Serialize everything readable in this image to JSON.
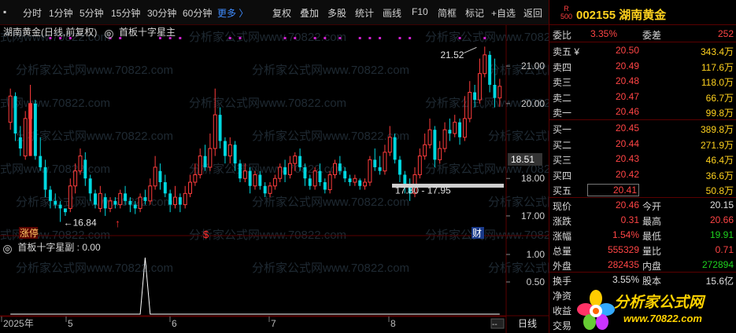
{
  "toolbar": {
    "periods": [
      "分时",
      "1分钟",
      "5分钟",
      "15分钟",
      "30分钟",
      "60分钟"
    ],
    "more": "更多 〉",
    "buttons": [
      "复权",
      "叠加",
      "多股",
      "统计",
      "画线",
      "F10",
      "简框",
      "标记",
      "+自选",
      "返回"
    ]
  },
  "main": {
    "legend": "湖南黄金(日线,前复权)",
    "indicator": "首板十字星主",
    "price_axis": [
      "21.00",
      "20.00",
      "18.00",
      "17.00"
    ],
    "current_price_tag": "18.51",
    "high_note": "21.52",
    "low_note": "←16.84",
    "range_note": "17.80 - 17.95",
    "markers": {
      "zhangting": "涨停",
      "dollar": "$",
      "cai": "财"
    }
  },
  "sub": {
    "legend": "首板十字星副 : 0.00",
    "axis": [
      "1.00",
      "0.50"
    ]
  },
  "xaxis": {
    "labels": [
      "2025年",
      "5",
      "6",
      "7",
      "8"
    ],
    "period": "日线"
  },
  "watermark": "分析家公式网www.70822.com",
  "stock": {
    "market_badge": "R\n500",
    "title": "002155 湖南黄金",
    "weibi_label": "委比",
    "weibi_value": "3.35%",
    "weicha_label": "委差",
    "weicha_value": "252"
  },
  "asks": [
    {
      "label": "卖五 ¥",
      "price": "20.50",
      "vol": "343.4万"
    },
    {
      "label": "卖四",
      "price": "20.49",
      "vol": "117.6万"
    },
    {
      "label": "卖三",
      "price": "20.48",
      "vol": "118.0万"
    },
    {
      "label": "卖二",
      "price": "20.47",
      "vol": "66.7万"
    },
    {
      "label": "卖一",
      "price": "20.46",
      "vol": "99.8万"
    }
  ],
  "bids": [
    {
      "label": "买一",
      "price": "20.45",
      "vol": "389.8万"
    },
    {
      "label": "买二",
      "price": "20.44",
      "vol": "271.9万"
    },
    {
      "label": "买三",
      "price": "20.43",
      "vol": "46.4万"
    },
    {
      "label": "买四",
      "price": "20.42",
      "vol": "36.6万"
    },
    {
      "label": "买五",
      "price": "20.41",
      "vol": "50.8万"
    }
  ],
  "quote": [
    {
      "l1": "现价",
      "v1": "20.46",
      "c1": "red",
      "l2": "今开",
      "v2": "20.15",
      "c2": "white"
    },
    {
      "l1": "涨跌",
      "v1": "0.31",
      "c1": "red",
      "l2": "最高",
      "v2": "20.66",
      "c2": "red"
    },
    {
      "l1": "涨幅",
      "v1": "1.54%",
      "c1": "red",
      "l2": "最低",
      "v2": "19.91",
      "c2": "green"
    },
    {
      "l1": "总量",
      "v1": "555329",
      "c1": "red",
      "l2": "量比",
      "v2": "0.71",
      "c2": "red"
    },
    {
      "l1": "外盘",
      "v1": "282435",
      "c1": "red",
      "l2": "内盘",
      "v2": "272894",
      "c2": "green"
    }
  ],
  "extra": [
    {
      "label": "换手",
      "value": "3.55%",
      "label2": "股本",
      "value2": "15.6亿"
    },
    {
      "label": "净资",
      "value": "",
      "label2": "",
      "value2": ""
    },
    {
      "label": "收益",
      "value": "",
      "label2": "",
      "value2": ""
    },
    {
      "label": "交易",
      "value": "",
      "label2": "",
      "value2": ""
    }
  ],
  "logo": {
    "text": "分析家公式网",
    "url": "www.70822.com"
  },
  "colors": {
    "up": "#ff3c3c",
    "down": "#00d8e0",
    "accent": "#ffd21e",
    "signal_dot": "#d020d0"
  },
  "chart_data": {
    "type": "candlestick",
    "ylim": [
      16.6,
      21.8
    ],
    "candles": [
      [
        19.5,
        20.2,
        20.4,
        19.3
      ],
      [
        20.2,
        19.2,
        20.3,
        19.0
      ],
      [
        19.1,
        18.8,
        19.4,
        18.6
      ],
      [
        18.6,
        19.6,
        19.8,
        18.5
      ],
      [
        19.6,
        20.0,
        20.5,
        19.6
      ],
      [
        20.0,
        18.6,
        20.1,
        18.5
      ],
      [
        18.6,
        18.3,
        19.1,
        18.2
      ],
      [
        18.3,
        17.7,
        18.5,
        17.5
      ],
      [
        17.7,
        17.4,
        17.8,
        17.2
      ],
      [
        17.4,
        17.3,
        17.6,
        17.2
      ],
      [
        17.3,
        17.2,
        17.4,
        16.84
      ],
      [
        17.2,
        17.1,
        17.2,
        17.0
      ],
      [
        17.2,
        17.8,
        18.0,
        17.1
      ],
      [
        17.8,
        18.2,
        18.4,
        17.6
      ],
      [
        18.2,
        18.6,
        18.8,
        18.1
      ],
      [
        18.5,
        18.0,
        18.7,
        17.8
      ],
      [
        18.0,
        17.6,
        18.1,
        17.4
      ],
      [
        17.6,
        17.3,
        17.7,
        17.2
      ],
      [
        17.2,
        17.6,
        17.8,
        17.1
      ],
      [
        17.5,
        17.2,
        17.6,
        17.0
      ],
      [
        17.2,
        17.4,
        17.5,
        17.1
      ],
      [
        17.4,
        17.3,
        17.5,
        17.2
      ],
      [
        17.3,
        17.6,
        17.7,
        17.2
      ],
      [
        17.6,
        17.4,
        17.8,
        17.3
      ],
      [
        17.4,
        17.3,
        17.5,
        17.1
      ],
      [
        17.3,
        17.2,
        17.4,
        17.05
      ],
      [
        17.2,
        17.5,
        17.6,
        17.1
      ],
      [
        17.5,
        17.4,
        17.7,
        17.3
      ],
      [
        17.4,
        17.8,
        18.0,
        17.3
      ],
      [
        17.8,
        18.3,
        18.6,
        17.7
      ],
      [
        18.2,
        17.9,
        18.4,
        17.7
      ],
      [
        17.9,
        17.6,
        18.1,
        17.5
      ],
      [
        17.6,
        17.3,
        17.7,
        17.1
      ],
      [
        17.3,
        17.5,
        17.8,
        17.2
      ],
      [
        17.5,
        17.3,
        17.6,
        17.1
      ],
      [
        17.3,
        17.6,
        17.8,
        17.2
      ],
      [
        17.6,
        17.9,
        18.1,
        17.5
      ],
      [
        17.9,
        18.1,
        18.4,
        17.8
      ],
      [
        18.1,
        18.6,
        18.8,
        18.0
      ],
      [
        18.6,
        18.3,
        18.9,
        18.2
      ],
      [
        18.3,
        18.8,
        19.2,
        18.2
      ],
      [
        18.8,
        19.7,
        20.4,
        18.6
      ],
      [
        19.7,
        19.0,
        19.9,
        18.8
      ],
      [
        19.0,
        18.6,
        19.1,
        18.4
      ],
      [
        18.6,
        18.9,
        19.1,
        18.4
      ],
      [
        18.9,
        18.4,
        19.0,
        18.2
      ],
      [
        18.4,
        18.0,
        18.5,
        17.9
      ],
      [
        18.0,
        18.2,
        18.4,
        17.9
      ],
      [
        18.2,
        17.8,
        18.3,
        17.6
      ],
      [
        17.8,
        18.1,
        18.2,
        17.7
      ],
      [
        18.1,
        17.8,
        18.2,
        17.7
      ],
      [
        17.8,
        17.6,
        17.9,
        17.5
      ],
      [
        17.6,
        17.8,
        17.9,
        17.5
      ],
      [
        17.8,
        18.0,
        18.1,
        17.7
      ],
      [
        18.0,
        18.3,
        18.4,
        17.9
      ],
      [
        18.3,
        18.1,
        18.5,
        17.9
      ],
      [
        18.1,
        18.4,
        18.6,
        18.0
      ],
      [
        18.4,
        18.6,
        18.7,
        18.2
      ],
      [
        18.6,
        18.3,
        18.8,
        18.2
      ],
      [
        18.3,
        18.0,
        18.4,
        17.8
      ],
      [
        18.0,
        17.8,
        18.1,
        17.7
      ],
      [
        17.8,
        18.2,
        18.3,
        17.7
      ],
      [
        18.2,
        17.9,
        18.4,
        17.8
      ],
      [
        17.9,
        17.7,
        18.0,
        17.6
      ],
      [
        17.7,
        18.1,
        18.2,
        17.6
      ],
      [
        18.1,
        18.4,
        18.5,
        18.0
      ],
      [
        18.4,
        18.2,
        18.6,
        18.1
      ],
      [
        18.2,
        18.0,
        18.3,
        17.9
      ],
      [
        18.0,
        17.9,
        18.1,
        17.8
      ],
      [
        17.9,
        18.0,
        18.1,
        17.8
      ],
      [
        17.95,
        17.8,
        18.0,
        17.7
      ],
      [
        17.8,
        17.9,
        18.0,
        17.7
      ],
      [
        17.9,
        18.5,
        18.6,
        17.8
      ],
      [
        18.5,
        18.3,
        18.8,
        18.2
      ],
      [
        18.3,
        18.2,
        18.6,
        18.1
      ],
      [
        18.2,
        18.7,
        18.9,
        18.1
      ],
      [
        18.7,
        19.1,
        19.4,
        18.6
      ],
      [
        19.1,
        18.5,
        19.2,
        18.4
      ],
      [
        18.5,
        18.1,
        18.6,
        17.9
      ],
      [
        18.1,
        17.85,
        18.2,
        17.6
      ],
      [
        17.85,
        17.6,
        18.0,
        17.4
      ],
      [
        17.6,
        18.1,
        18.3,
        17.5
      ],
      [
        18.1,
        18.6,
        18.8,
        18.0
      ],
      [
        18.6,
        18.9,
        19.2,
        18.5
      ],
      [
        18.9,
        19.3,
        19.6,
        18.8
      ],
      [
        19.3,
        18.5,
        19.4,
        18.3
      ],
      [
        18.5,
        18.8,
        19.0,
        18.4
      ],
      [
        18.8,
        19.3,
        19.5,
        18.7
      ],
      [
        19.3,
        19.2,
        19.6,
        19.0
      ],
      [
        19.2,
        19.5,
        19.7,
        19.1
      ],
      [
        19.5,
        19.1,
        19.6,
        18.9
      ],
      [
        19.1,
        19.6,
        20.2,
        19.0
      ],
      [
        19.6,
        20.3,
        20.6,
        19.5
      ],
      [
        20.3,
        20.1,
        20.5,
        19.9
      ],
      [
        20.1,
        20.8,
        21.2,
        20.0
      ],
      [
        20.8,
        21.3,
        21.52,
        20.7
      ],
      [
        21.3,
        20.5,
        21.4,
        20.3
      ],
      [
        20.5,
        20.15,
        21.2,
        19.9
      ],
      [
        20.15,
        20.46,
        20.66,
        19.91
      ]
    ],
    "signal_series": {
      "name": "首板十字星副",
      "peak_index": 27,
      "ylim": [
        0,
        1
      ]
    }
  }
}
